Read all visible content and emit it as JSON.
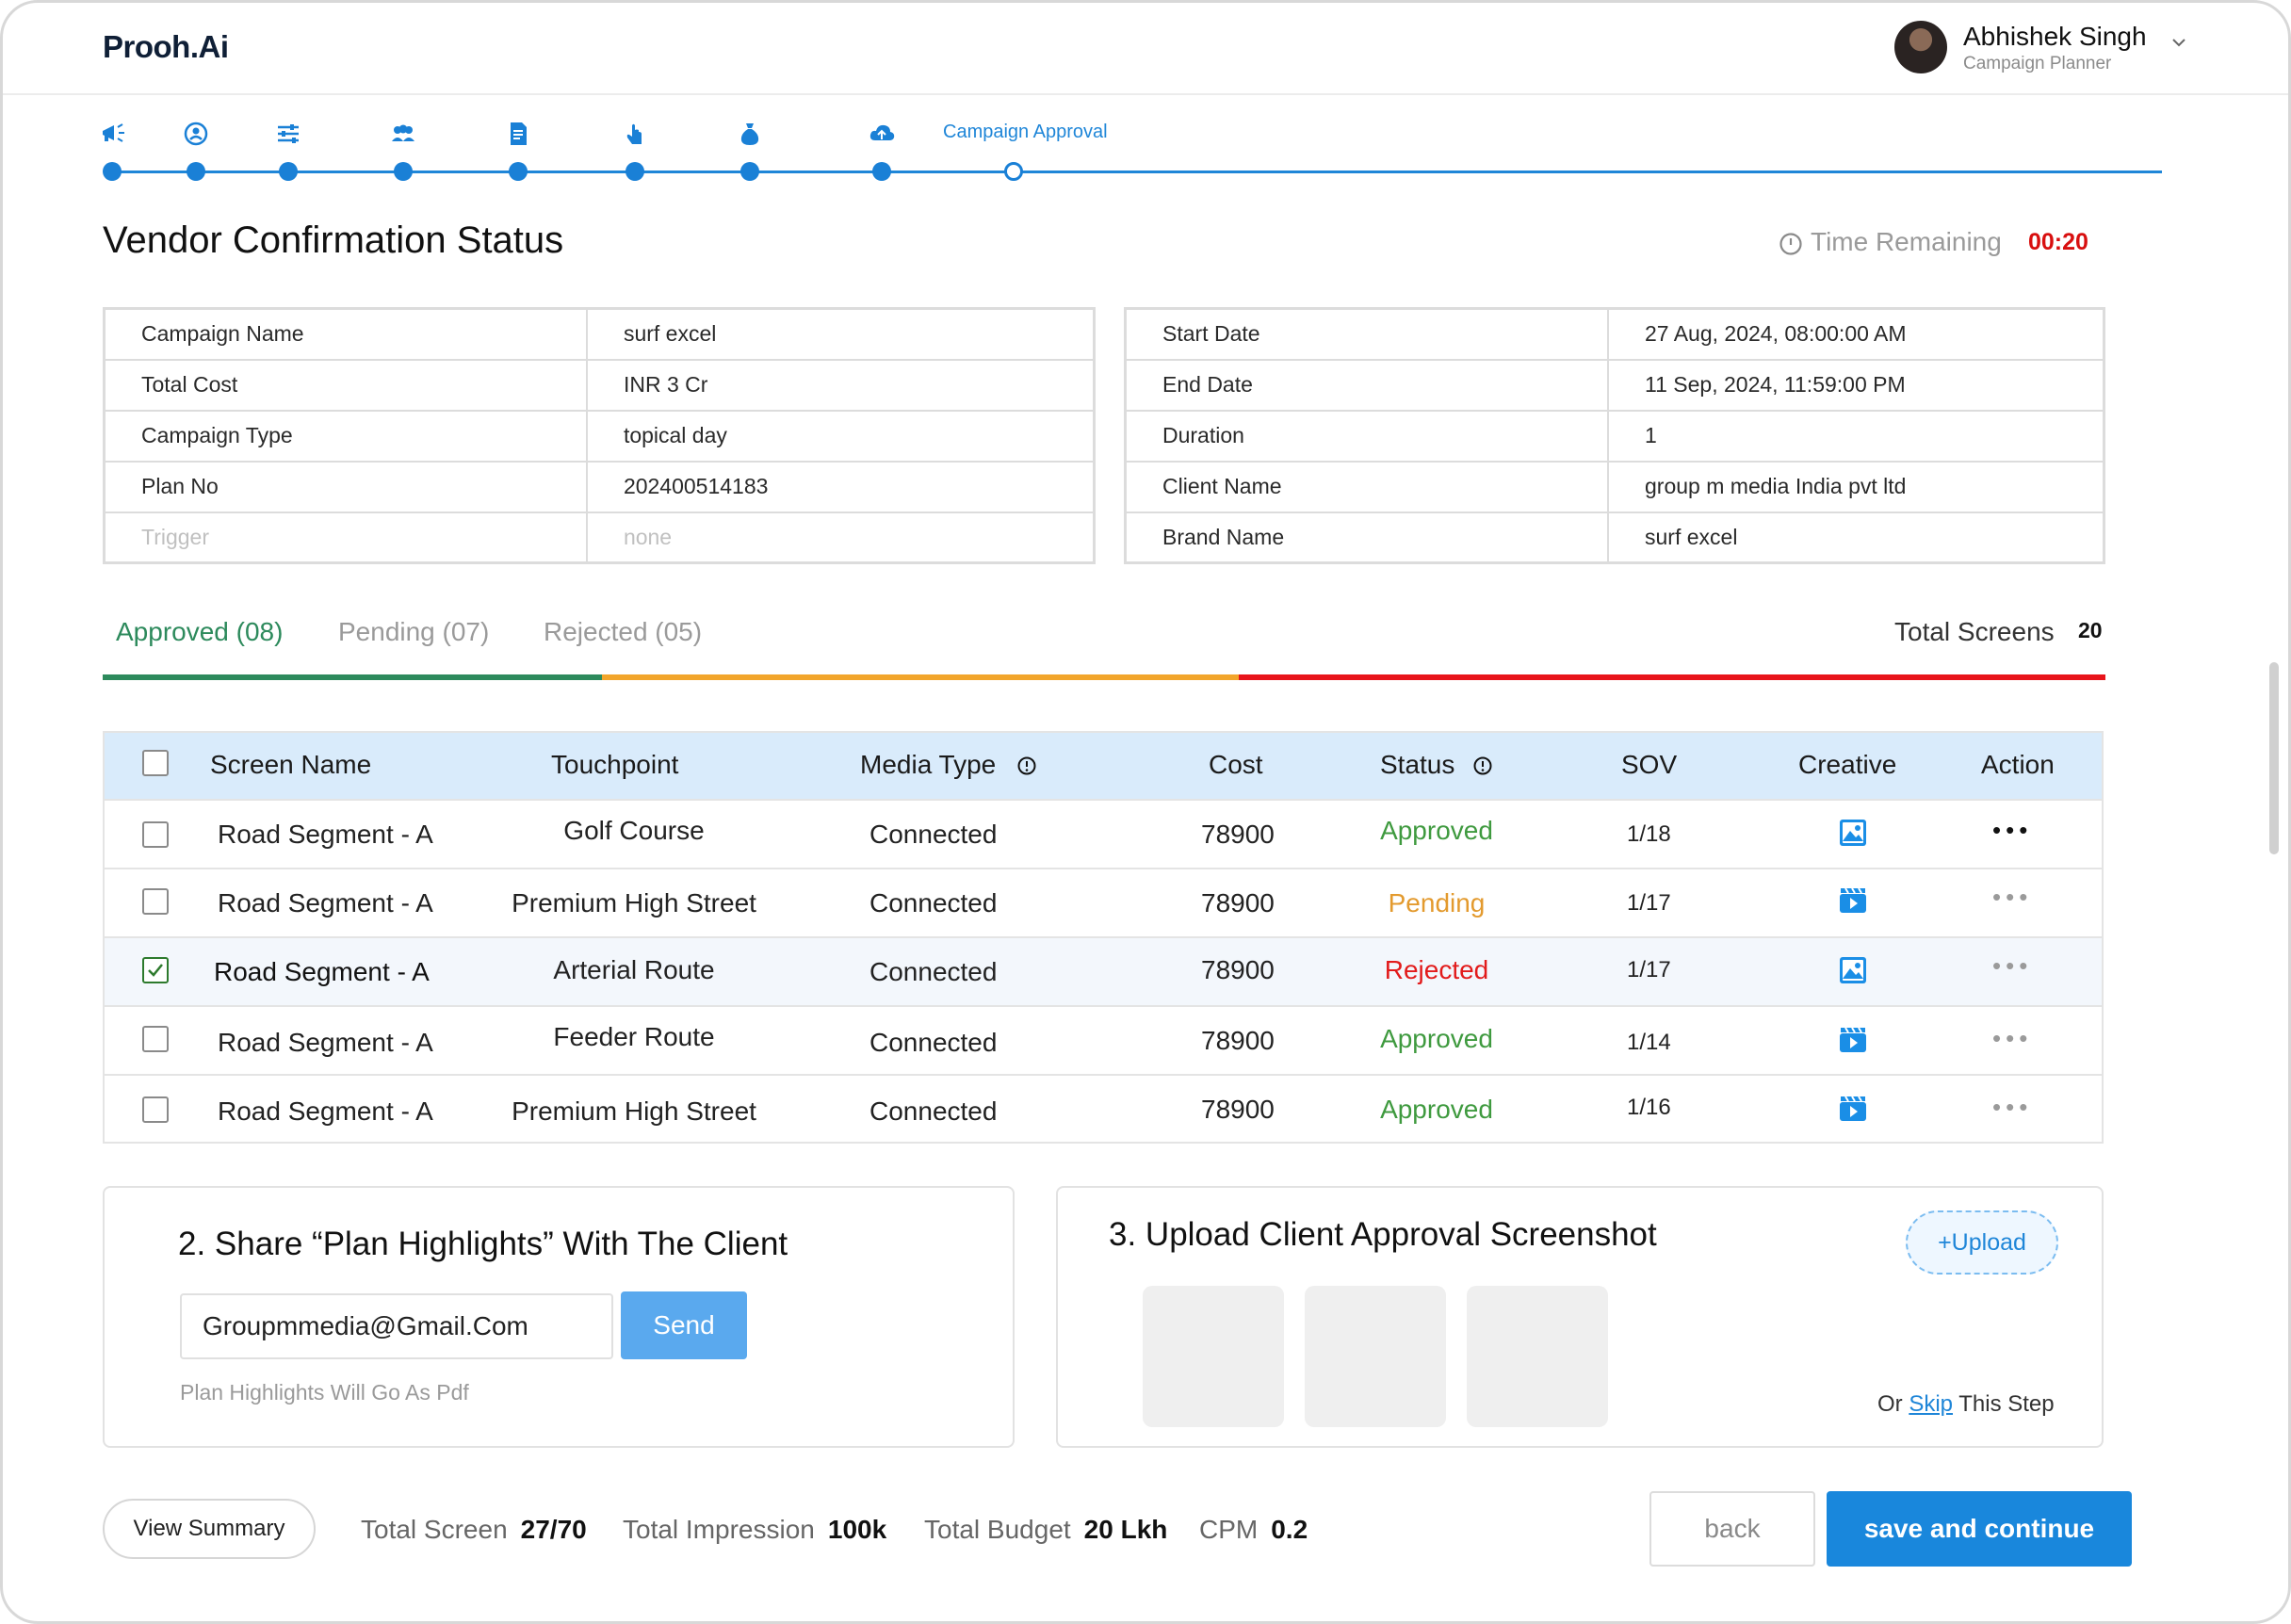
{
  "header": {
    "logo": "Prooh.Ai",
    "user_name": "Abhishek Singh",
    "user_role": "Campaign Planner"
  },
  "stepper": {
    "current_label": "Campaign Approval",
    "icons": [
      "megaphone-icon",
      "target-icon",
      "sliders-icon",
      "users-icon",
      "document-icon",
      "touch-icon",
      "moneybag-icon",
      "cloud-upload-icon"
    ]
  },
  "page": {
    "title": "Vendor Confirmation Status",
    "time_remaining_label": "Time Remaining",
    "time_remaining_value": "00:20"
  },
  "info_left": [
    {
      "label": "Campaign Name",
      "value": "surf excel"
    },
    {
      "label": "Total Cost",
      "value": "INR 3 Cr"
    },
    {
      "label": "Campaign Type",
      "value": "topical day"
    },
    {
      "label": "Plan No",
      "value": "202400514183"
    },
    {
      "label": "Trigger",
      "value": "none"
    }
  ],
  "info_right": [
    {
      "label": "Start Date",
      "value": "27 Aug, 2024, 08:00:00 AM"
    },
    {
      "label": "End Date",
      "value": "11 Sep, 2024, 11:59:00 PM"
    },
    {
      "label": "Duration",
      "value": "1"
    },
    {
      "label": "Client Name",
      "value": "group m media India pvt ltd"
    },
    {
      "label": "Brand Name",
      "value": "surf excel"
    }
  ],
  "tabs": {
    "approved": "Approved (08)",
    "pending": "Pending  (07)",
    "rejected": "Rejected (05)",
    "total_screens_label": "Total Screens",
    "total_screens_value": "20",
    "colors": {
      "approved": "#2d8a5c",
      "pending": "#f2a52b",
      "rejected": "#e8141b"
    }
  },
  "table": {
    "headers": [
      "Screen Name",
      "Touchpoint",
      "Media Type",
      "Cost",
      "Status",
      "SOV",
      "Creative",
      "Action"
    ],
    "rows": [
      {
        "screen": "Road Segment - A",
        "touchpoint": "Golf Course",
        "media": "Connected",
        "cost": "78900",
        "status": "Approved",
        "sov": "1/18",
        "creative": "image-icon",
        "checked": false
      },
      {
        "screen": "Road Segment - A",
        "touchpoint": "Premium High Street",
        "media": "Connected",
        "cost": "78900",
        "status": "Pending",
        "sov": "1/17",
        "creative": "video-icon",
        "checked": false
      },
      {
        "screen": "Road Segment - A",
        "touchpoint": "Arterial Route",
        "media": "Connected",
        "cost": "78900",
        "status": "Rejected",
        "sov": "1/17",
        "creative": "image-icon",
        "checked": true
      },
      {
        "screen": "Road Segment - A",
        "touchpoint": "Feeder Route",
        "media": "Connected",
        "cost": "78900",
        "status": "Approved",
        "sov": "1/14",
        "creative": "video-icon",
        "checked": false
      },
      {
        "screen": "Road Segment - A",
        "touchpoint": "Premium High Street",
        "media": "Connected",
        "cost": "78900",
        "status": "Approved",
        "sov": "1/16",
        "creative": "video-icon",
        "checked": false
      }
    ],
    "action_dots": "•••"
  },
  "share_panel": {
    "title": "2. Share “Plan Highlights”  With The Client",
    "email_value": "Groupmmedia@Gmail.Com",
    "send_label": "Send",
    "hint": "Plan Highlights Will Go As Pdf"
  },
  "upload_panel": {
    "title": "3.  Upload Client Approval Screenshot",
    "upload_label": "+Upload",
    "skip_prefix": "Or ",
    "skip_link": "Skip",
    "skip_suffix": " This Step"
  },
  "footer": {
    "view_summary": "View Summary",
    "total_screen_label": "Total Screen",
    "total_screen_value": "27/70",
    "total_impression_label": "Total Impression",
    "total_impression_value": "100k",
    "total_budget_label": "Total Budget",
    "total_budget_value": "20 Lkh",
    "cpm_label": "CPM",
    "cpm_value": "0.2",
    "back_label": "back",
    "save_label": "save and continue"
  }
}
